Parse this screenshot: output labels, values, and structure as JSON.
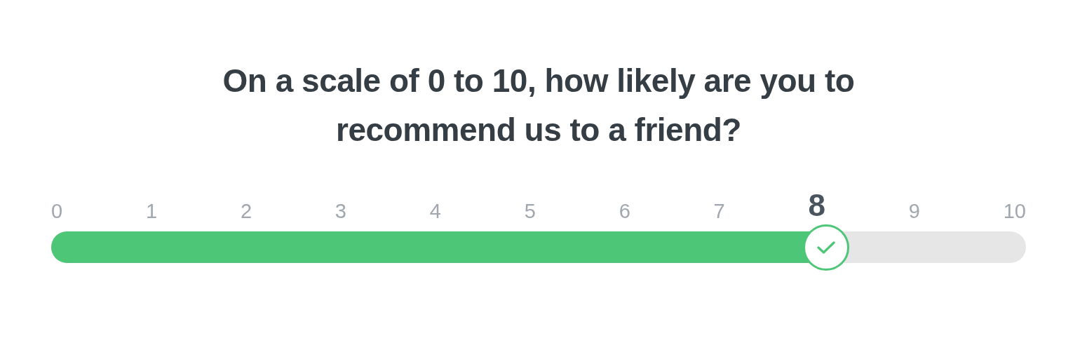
{
  "question": "On a scale of 0 to 10, how likely are you to recommend us to a friend?",
  "scale": [
    {
      "label": "0",
      "selected": false
    },
    {
      "label": "1",
      "selected": false
    },
    {
      "label": "2",
      "selected": false
    },
    {
      "label": "3",
      "selected": false
    },
    {
      "label": "4",
      "selected": false
    },
    {
      "label": "5",
      "selected": false
    },
    {
      "label": "6",
      "selected": false
    },
    {
      "label": "7",
      "selected": false
    },
    {
      "label": "8",
      "selected": true
    },
    {
      "label": "9",
      "selected": false
    },
    {
      "label": "10",
      "selected": false
    }
  ],
  "slider": {
    "level": 0.8
  }
}
